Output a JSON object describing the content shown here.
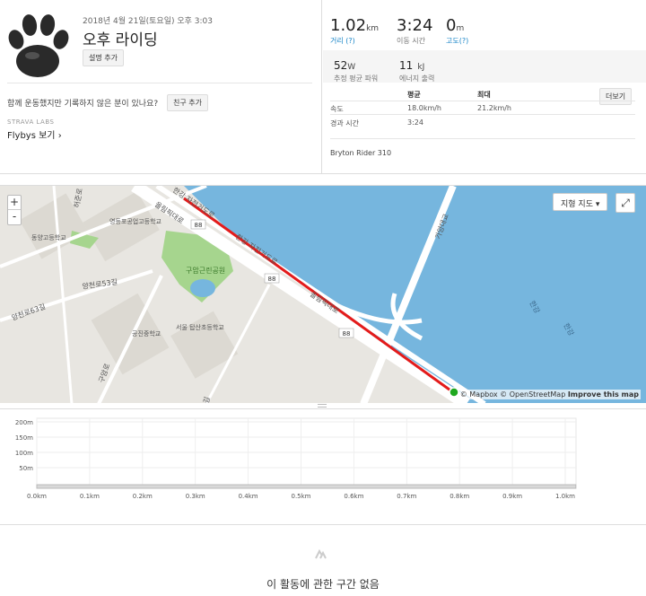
{
  "activity": {
    "date": "2018년 4월 21일(토요일) 오후 3:03",
    "title": "오후 라이딩",
    "add_description": "설명 추가",
    "friends_prompt": "함께 운동했지만 기록하지 않은 분이 있나요?",
    "add_friend": "친구 추가",
    "labs": "STRAVA LABS",
    "flybys": "Flybys 보기",
    "avatar_icon": "paw-print-icon"
  },
  "stats": {
    "distance": {
      "value": "1.02",
      "unit": "km",
      "label": "거리 (?)"
    },
    "moving_time": {
      "value": "3:24",
      "label": "이동 시간"
    },
    "elevation": {
      "value": "0",
      "unit": "m",
      "label": "고도(?)"
    },
    "power": {
      "value": "52",
      "unit": "W",
      "label": "추정 평균 파워"
    },
    "energy": {
      "value": "11",
      "unit": "kJ",
      "label": "에너지 출력"
    }
  },
  "table": {
    "col_avg": "평균",
    "col_max": "최대",
    "more": "더보기",
    "rows": [
      {
        "label": "속도",
        "avg": "18.0km/h",
        "max": "21.2km/h"
      },
      {
        "label": "경과 시간",
        "avg": "3:24",
        "max": ""
      }
    ],
    "device": "Bryton Rider 310"
  },
  "map": {
    "zoom_in": "+",
    "zoom_out": "-",
    "terrain": "지형 지도",
    "attribution_prefix": "© Mapbox © OpenStreetMap",
    "attribution_link": "Improve this map",
    "labels": {
      "river": "가양대교",
      "river_label_1": "한강",
      "river_label_2": "한강",
      "road1": "올림픽대로",
      "road2": "올림픽대로",
      "road3": "한강 자전거도로",
      "road4": "한강 자전거도로",
      "road5": "양천로53길",
      "road6": "양천로63길",
      "road7": "구암로",
      "road8": "허준로",
      "road9": "길",
      "park": "구암근린공원",
      "school1": "영등포공업고등학교",
      "school2": "동양고등학교",
      "school3": "공진중학교",
      "school4": "서울 탑산초등학교",
      "route88": "88"
    }
  },
  "chart_data": {
    "type": "area",
    "title": "",
    "xlabel": "",
    "ylabel": "",
    "x_ticks": [
      "0.0km",
      "0.1km",
      "0.2km",
      "0.3km",
      "0.4km",
      "0.5km",
      "0.6km",
      "0.7km",
      "0.8km",
      "0.9km",
      "1.0km"
    ],
    "y_ticks": [
      "50m",
      "100m",
      "150m",
      "200m"
    ],
    "xlim": [
      0,
      1.02
    ],
    "ylim": [
      0,
      200
    ],
    "x": [
      0,
      0.2,
      0.4,
      0.6,
      0.8,
      1.02
    ],
    "values": [
      0,
      0,
      0,
      0,
      0,
      0
    ],
    "grid": true
  },
  "segments": {
    "icon": "strava-segment-icon",
    "empty_text": "이 활동에 관한 구간 없음"
  }
}
